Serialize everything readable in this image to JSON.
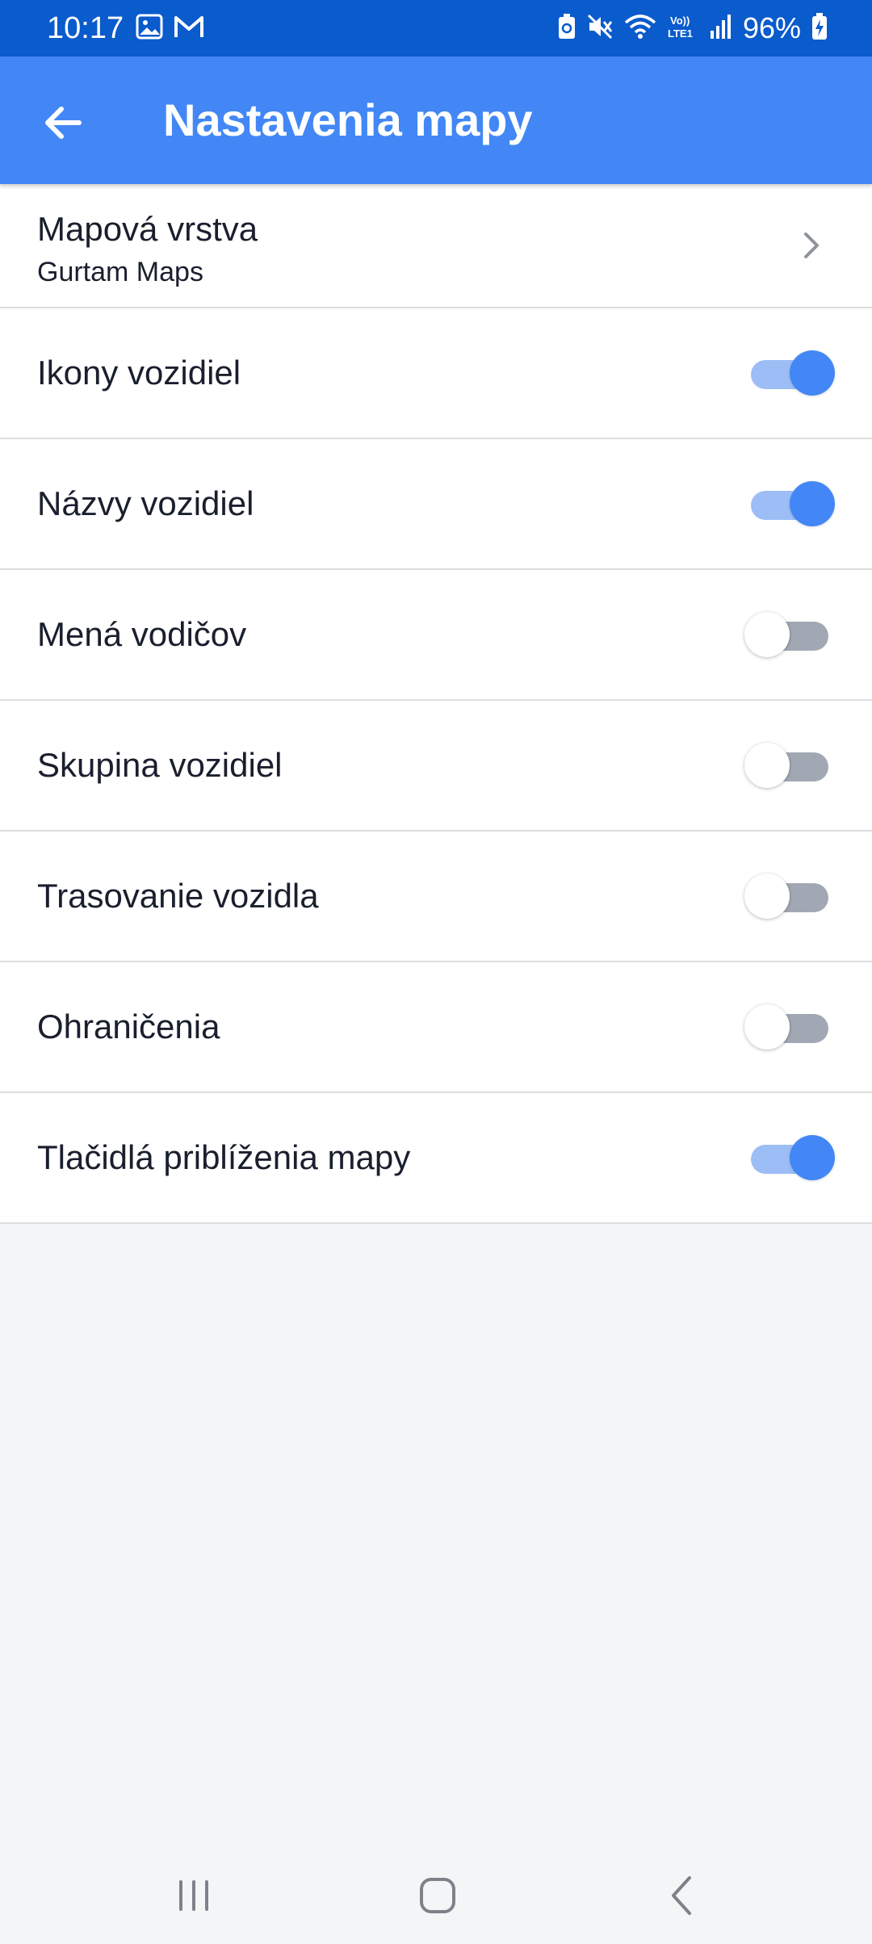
{
  "status_bar": {
    "time": "10:17",
    "battery": "96%",
    "left_icons": [
      "gallery-icon",
      "gmail-icon"
    ],
    "right_icons": [
      "battery-saver-icon",
      "mute-icon",
      "wifi-icon",
      "volte-icon",
      "signal-icon",
      "battery-icon"
    ]
  },
  "app_bar": {
    "title": "Nastavenia mapy",
    "back_icon": "arrow-left-icon"
  },
  "settings": {
    "map_layer": {
      "title": "Mapová vrstva",
      "value": "Gurtam Maps"
    },
    "toggles": [
      {
        "label": "Ikony vozidiel",
        "on": true
      },
      {
        "label": "Názvy vozidiel",
        "on": true
      },
      {
        "label": "Mená vodičov",
        "on": false
      },
      {
        "label": "Skupina vozidiel",
        "on": false
      },
      {
        "label": "Trasovanie vozidla",
        "on": false
      },
      {
        "label": "Ohraničenia",
        "on": false
      },
      {
        "label": "Tlačidlá priblíženia mapy",
        "on": true
      }
    ]
  },
  "nav_bar": {
    "buttons": [
      "recent-apps-icon",
      "home-icon",
      "back-icon"
    ]
  },
  "colors": {
    "status_bar": "#0a5bcc",
    "app_bar": "#4287f5",
    "toggle_on_knob": "#4287f5",
    "toggle_on_track": "#9cbdf5",
    "toggle_off_track": "#a2a8b3",
    "background": "#f4f5f7"
  }
}
